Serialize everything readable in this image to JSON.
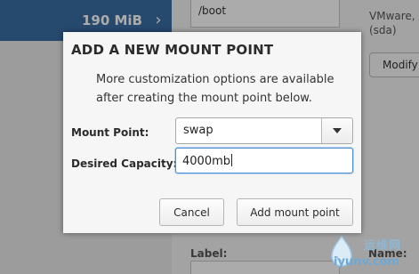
{
  "background": {
    "selected_item_size": "190 MiB",
    "mount_point_value": "/boot",
    "device_line1": "VMware,",
    "device_line2": "(sda)",
    "modify_button": "Modify",
    "label_heading": "Label:",
    "name_heading": "Name:"
  },
  "dialog": {
    "title": "ADD A NEW MOUNT POINT",
    "description": "More customization options are available after creating the mount point below.",
    "mount_point_label": "Mount Point:",
    "mount_point_value": "swap",
    "capacity_label": "Desired Capacity:",
    "capacity_value": "4000mb",
    "cancel_label": "Cancel",
    "add_label": "Add mount point"
  },
  "watermark": {
    "text_cn": "运维网",
    "url": "iyunv.com"
  },
  "colors": {
    "selection": "#3a6ea5",
    "focus": "#4a90d9"
  }
}
